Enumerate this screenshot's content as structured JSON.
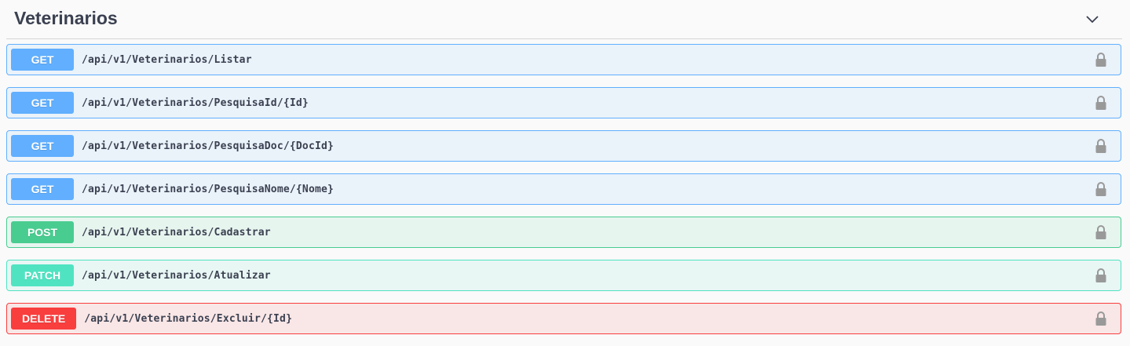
{
  "section": {
    "title": "Veterinarios",
    "collapse_icon": "chevron-down-icon"
  },
  "colors": {
    "get": "#61affe",
    "post": "#49cc90",
    "patch": "#50e3c2",
    "delete": "#f93e3e",
    "text": "#3b4151",
    "lock": "#999999"
  },
  "operations": [
    {
      "method": "GET",
      "path": "/api/v1/Veterinarios/Listar",
      "icon": "lock-icon"
    },
    {
      "method": "GET",
      "path": "/api/v1/Veterinarios/PesquisaId/{Id}",
      "icon": "lock-icon"
    },
    {
      "method": "GET",
      "path": "/api/v1/Veterinarios/PesquisaDoc/{DocId}",
      "icon": "lock-icon"
    },
    {
      "method": "GET",
      "path": "/api/v1/Veterinarios/PesquisaNome/{Nome}",
      "icon": "lock-icon"
    },
    {
      "method": "POST",
      "path": "/api/v1/Veterinarios/Cadastrar",
      "icon": "lock-icon"
    },
    {
      "method": "PATCH",
      "path": "/api/v1/Veterinarios/Atualizar",
      "icon": "lock-icon"
    },
    {
      "method": "DELETE",
      "path": "/api/v1/Veterinarios/Excluir/{Id}",
      "icon": "lock-icon"
    }
  ]
}
